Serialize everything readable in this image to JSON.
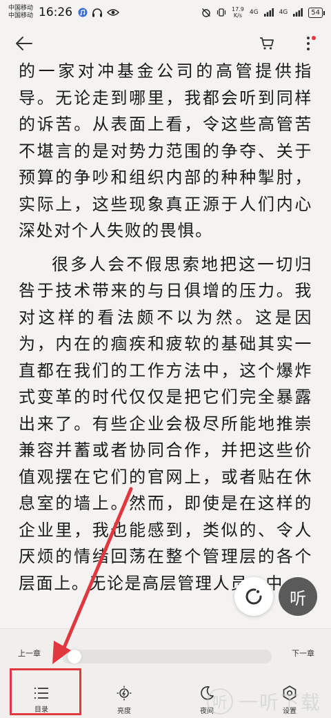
{
  "status_bar": {
    "carrier1": "中国移动",
    "carrier2": "中国移动",
    "time": "16:26",
    "speed_value": "17.9",
    "speed_unit": "K/s",
    "signal1": "4G",
    "signal2": "4G",
    "battery": "54"
  },
  "content": {
    "paragraphs": [
      "的一家对冲基金公司的高管提供指导。无论走到哪里，我都会听到同样的诉苦。从表面上看，令这些高管苦不堪言的是对势力范围的争夺、关于预算的争吵和组织内部的种种掣肘，实际上，这些现象真正源于人们内心深处对个人失败的畏惧。",
      "很多人会不假思索地把这一切归咎于技术带来的与日俱增的压力。我对这样的看法颇不以为然。这是因为，内在的痼疾和疲软的基础其实一直都在我们的工作方法中，这个爆炸式变革的时代仅仅是把它们完全暴露出来了。有些企业会极尽所能地推崇兼容并蓄或者协同合作，并把这些价值观摆在它们的官网上，或者贴在休息室的墙上。然而，即使是在这样的企业里，我也能感到，类似的、令人厌烦的情绪回荡在整个管理层的各个层面上。无论是高层管理人员、中"
    ]
  },
  "floating": {
    "listen_label": "听"
  },
  "bottom": {
    "prev_chapter": "上一章",
    "next_chapter": "下一章",
    "progress": 0.02,
    "tabs": [
      {
        "label": "目录",
        "icon": "list-icon"
      },
      {
        "label": "亮度",
        "icon": "brightness-icon"
      },
      {
        "label": "夜间",
        "icon": "moon-icon"
      },
      {
        "label": "设置",
        "icon": "settings-icon"
      }
    ]
  },
  "watermark": {
    "logo_char": "听",
    "text": "一听下载"
  },
  "colors": {
    "accent_red": "#e0383e",
    "background": "#f4f3f1"
  }
}
